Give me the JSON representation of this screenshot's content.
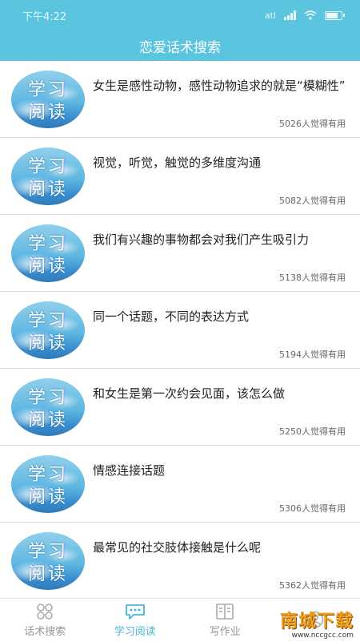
{
  "status_bar": {
    "time": "下午4:22",
    "network": "atl"
  },
  "header": {
    "title": "恋爱话术搜索"
  },
  "thumbnail": {
    "line1": "学习",
    "line2": "阅读"
  },
  "articles": [
    {
      "title": "女生是感性动物，感性动物追求的就是“模糊性”",
      "count": "5026人觉得有用"
    },
    {
      "title": "视觉，听觉，触觉的多维度沟通",
      "count": "5082人觉得有用"
    },
    {
      "title": "我们有兴趣的事物都会对我们产生吸引力",
      "count": "5138人觉得有用"
    },
    {
      "title": "同一个话题，不同的表达方式",
      "count": "5194人觉得有用"
    },
    {
      "title": "和女生是第一次约会见面，该怎么做",
      "count": "5250人觉得有用"
    },
    {
      "title": "情感连接话题",
      "count": "5306人觉得有用"
    },
    {
      "title": "最常见的社交肢体接触是什么呢",
      "count": "5362人觉得有用"
    }
  ],
  "tabs": [
    {
      "label": "话术搜索",
      "icon": "grid-icon",
      "active": false
    },
    {
      "label": "学习阅读",
      "icon": "chat-icon",
      "active": true
    },
    {
      "label": "写作业",
      "icon": "book-icon",
      "active": false
    },
    {
      "label": "",
      "icon": "user-icon",
      "active": false
    }
  ],
  "watermark": {
    "main": "南城下载",
    "url": "www.nccgcc.com"
  },
  "colors": {
    "primary": "#5bc4df",
    "active_tab": "#4bb7d6",
    "inactive_tab": "#999999"
  }
}
